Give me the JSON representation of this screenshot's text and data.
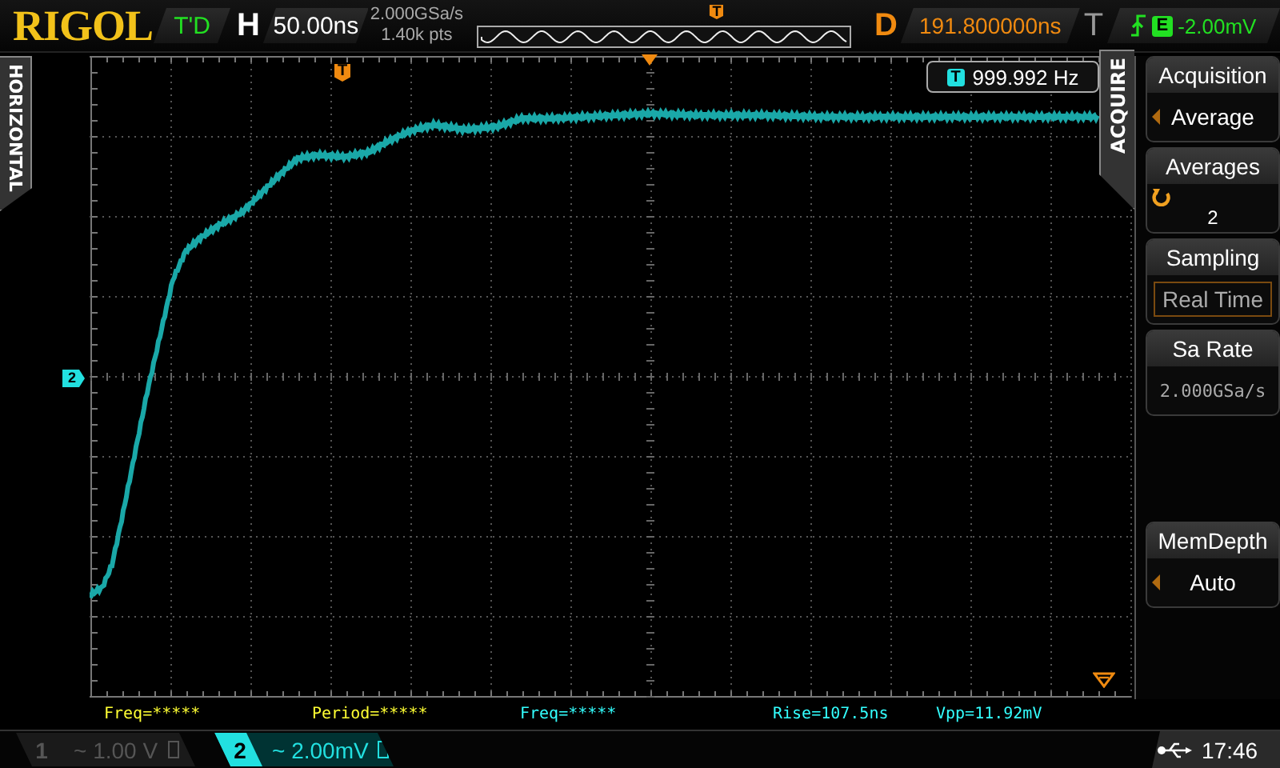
{
  "brand": "RIGOL",
  "status": "T'D",
  "timebase": {
    "label": "H",
    "value": "50.00ns"
  },
  "sample_rate": "2.000GSa/s",
  "memory_depth": "1.40k pts",
  "memory_trigger_mark": "T",
  "trigger_position_mark": "T",
  "delay": {
    "label": "D",
    "value": "191.800000ns"
  },
  "trigger": {
    "label": "T",
    "source": "E",
    "level": "-2.00mV"
  },
  "left_tab": "HORIZONTAL",
  "right_tab": "ACQUIRE",
  "counter": {
    "badge": "T",
    "value": "999.992 Hz"
  },
  "channel_marker": "2",
  "menu": [
    {
      "kind": "select",
      "title": "Acquisition",
      "value": "Average"
    },
    {
      "kind": "knob",
      "title": "Averages",
      "value": "2"
    },
    {
      "kind": "fixed",
      "title": "Sampling",
      "value": "Real Time"
    },
    {
      "kind": "readonly",
      "title": "Sa Rate",
      "value": "2.000GSa/s"
    }
  ],
  "menu_bottom": [
    {
      "kind": "select",
      "title": "MemDepth",
      "value": "Auto"
    }
  ],
  "measurements": [
    {
      "text": "Freq=*****",
      "color": "#ffff33"
    },
    {
      "text": "Period=*****",
      "color": "#ffff33"
    },
    {
      "text": "Freq=*****",
      "color": "#33ffff"
    },
    {
      "text": "Rise=107.5ns",
      "color": "#33ffff"
    },
    {
      "text": "Vpp=11.92mV",
      "color": "#33ffff"
    }
  ],
  "channels": [
    {
      "number": "1",
      "coupling": "~",
      "scale": "1.00 V",
      "on": false
    },
    {
      "number": "2",
      "coupling": "~",
      "scale": "2.00mV",
      "on": true
    }
  ],
  "clock": "17:46"
}
